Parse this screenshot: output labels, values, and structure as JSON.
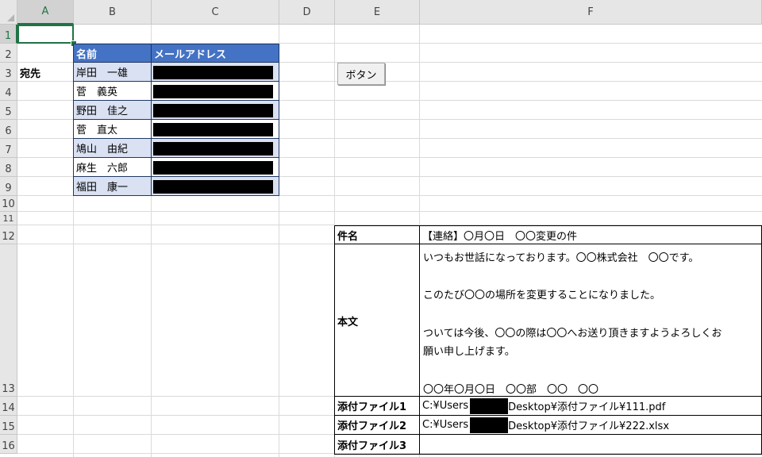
{
  "columns": [
    "A",
    "B",
    "C",
    "D",
    "E",
    "F"
  ],
  "rows": [
    "1",
    "2",
    "3",
    "4",
    "5",
    "6",
    "7",
    "8",
    "9",
    "10",
    "11",
    "12",
    "13",
    "14",
    "15",
    "16"
  ],
  "recipient_label": "宛先",
  "recipients_table": {
    "headers": [
      "名前",
      "メールアドレス"
    ],
    "names": [
      "岸田　一雄",
      "菅　義英",
      "野田　佳之",
      "菅　直太",
      "鳩山　由紀",
      "麻生　六郎",
      "福田　康一"
    ]
  },
  "button_label": "ボタン",
  "mail": {
    "subject_label": "件名",
    "subject_value": "【連絡】〇月〇日　〇〇変更の件",
    "body_label": "本文",
    "body_lines": [
      "いつもお世話になっております。〇〇株式会社　〇〇です。",
      "このたび〇〇の場所を変更することになりました。",
      "ついては今後、〇〇の際は〇〇へお送り頂きますようよろしくお",
      "願い申し上げます。",
      "〇〇年〇月〇日　〇〇部　〇〇　〇〇"
    ],
    "attachments": [
      {
        "label": "添付ファイル1",
        "prefix": "C:¥Users",
        "suffix": "Desktop¥添付ファイル¥111.pdf"
      },
      {
        "label": "添付ファイル2",
        "prefix": "C:¥Users",
        "suffix": "Desktop¥添付ファイル¥222.xlsx"
      },
      {
        "label": "添付ファイル3",
        "prefix": "",
        "suffix": ""
      }
    ]
  },
  "colors": {
    "header_blue": "#4472c4",
    "band_blue": "#d9e1f2",
    "excel_green": "#217346"
  }
}
